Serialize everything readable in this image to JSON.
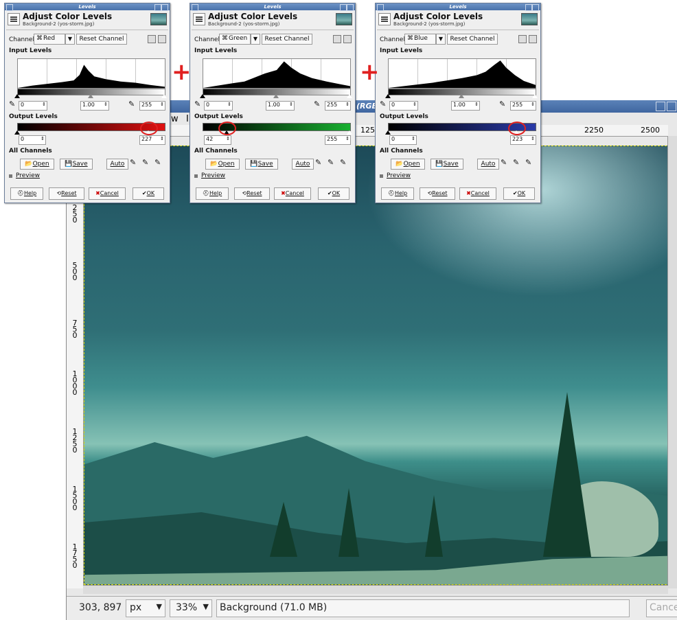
{
  "image_window": {
    "title_fragment": "(RGB",
    "menu_fragments": [
      "w",
      "Ir"
    ],
    "ruler_marks": [
      "125",
      "2250",
      "2500"
    ],
    "vertical_ruler_marks": [
      "250",
      "500",
      "750",
      "1000",
      "1250",
      "1500",
      "1750"
    ],
    "status": {
      "coords": "303, 897",
      "unit": "px",
      "zoom": "33%",
      "info": "Background (71.0 MB)",
      "cancel": "Cancel"
    }
  },
  "dialogs": [
    {
      "window_title": "Levels",
      "heading": "Adjust Color Levels",
      "subheading": "Background-2 (yos-storm.jpg)",
      "channel_label": "Channel:",
      "channel_value": "Red",
      "reset_channel": "Reset Channel",
      "input_levels_label": "Input Levels",
      "in_low": "0",
      "in_gamma": "1.00",
      "in_high": "255",
      "output_levels_label": "Output Levels",
      "out_low": "0",
      "out_high": "227",
      "all_channels_label": "All Channels",
      "open_btn": "Open",
      "save_btn": "Save",
      "auto_btn": "Auto",
      "preview_label": "Preview",
      "help_btn": "Help",
      "reset_btn": "Reset",
      "cancel_btn": "Cancel",
      "ok_btn": "OK",
      "output_color": "#e01010"
    },
    {
      "window_title": "Levels",
      "heading": "Adjust Color Levels",
      "subheading": "Background-2 (yos-storm.jpg)",
      "channel_label": "Channel:",
      "channel_value": "Green",
      "reset_channel": "Reset Channel",
      "input_levels_label": "Input Levels",
      "in_low": "0",
      "in_gamma": "1.00",
      "in_high": "255",
      "output_levels_label": "Output Levels",
      "out_low": "42",
      "out_high": "255",
      "all_channels_label": "All Channels",
      "open_btn": "Open",
      "save_btn": "Save",
      "auto_btn": "Auto",
      "preview_label": "Preview",
      "help_btn": "Help",
      "reset_btn": "Reset",
      "cancel_btn": "Cancel",
      "ok_btn": "OK",
      "output_color": "#18b030"
    },
    {
      "window_title": "Levels",
      "heading": "Adjust Color Levels",
      "subheading": "Background-2 (yos-storm.jpg)",
      "channel_label": "Channel:",
      "channel_value": "Blue",
      "reset_channel": "Reset Channel",
      "input_levels_label": "Input Levels",
      "in_low": "0",
      "in_gamma": "1.00",
      "in_high": "255",
      "output_levels_label": "Output Levels",
      "out_low": "0",
      "out_high": "223",
      "all_channels_label": "All Channels",
      "open_btn": "Open",
      "save_btn": "Save",
      "auto_btn": "Auto",
      "preview_label": "Preview",
      "help_btn": "Help",
      "reset_btn": "Reset",
      "cancel_btn": "Cancel",
      "ok_btn": "OK",
      "output_color": "#2a3aa8"
    }
  ],
  "plus_signs": [
    "+",
    "+"
  ],
  "annotation_color": "#e02020"
}
